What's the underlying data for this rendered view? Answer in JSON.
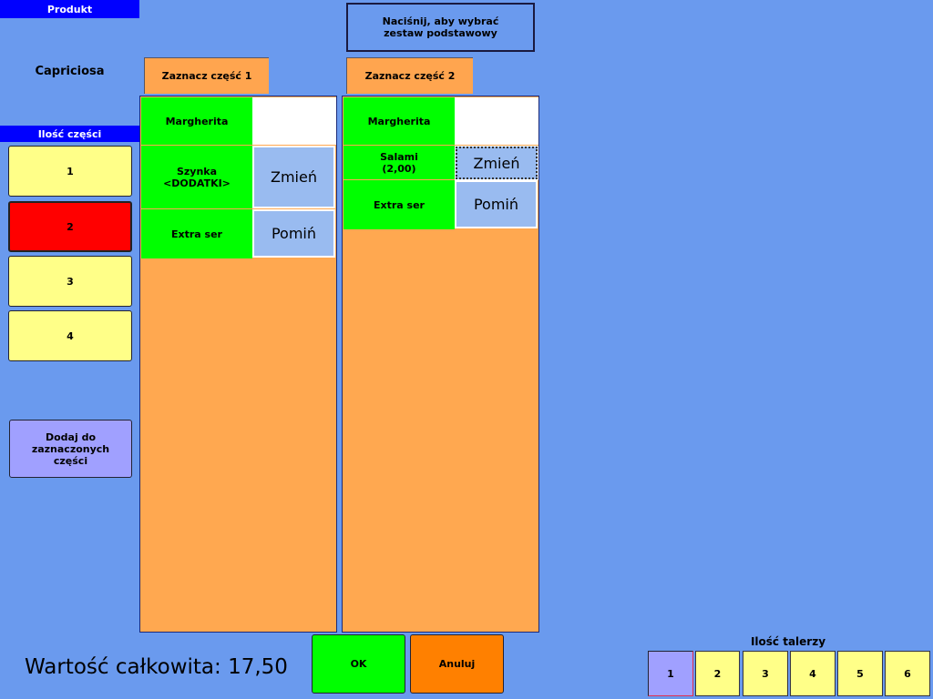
{
  "left": {
    "product_header": "Produkt",
    "product_name": "Capriciosa",
    "parts_header": "Ilość części",
    "parts_buttons": [
      "1",
      "2",
      "3",
      "4"
    ],
    "selected_parts": "2",
    "add_button": "Dodaj do zaznaczonych części"
  },
  "top_button": "Naciśnij, aby wybrać zestaw podstawowy",
  "parts": [
    {
      "tab": "Zaznacz część 1",
      "rows": [
        {
          "name": "Margherita"
        },
        {
          "name": "Szynka <DODATKI>",
          "action": "Zmień"
        },
        {
          "name": "Extra ser",
          "action": "Pomiń"
        }
      ]
    },
    {
      "tab": "Zaznacz część 2",
      "rows": [
        {
          "name": "Margherita"
        },
        {
          "name": "Salami (2,00)",
          "action": "Zmień"
        },
        {
          "name": "Extra ser",
          "action": "Pomiń"
        }
      ]
    }
  ],
  "footer": {
    "total": "Wartość całkowita: 17,50",
    "ok": "OK",
    "cancel": "Anuluj",
    "plates_label": "Ilość talerzy",
    "plates": [
      "1",
      "2",
      "3",
      "4",
      "5",
      "6"
    ],
    "selected_plates": "1"
  },
  "colors": {
    "background": "#6a9aee",
    "header": "#0000ff",
    "selected": "#ff0000",
    "item": "#00ff00",
    "panel": "#ffa850"
  }
}
